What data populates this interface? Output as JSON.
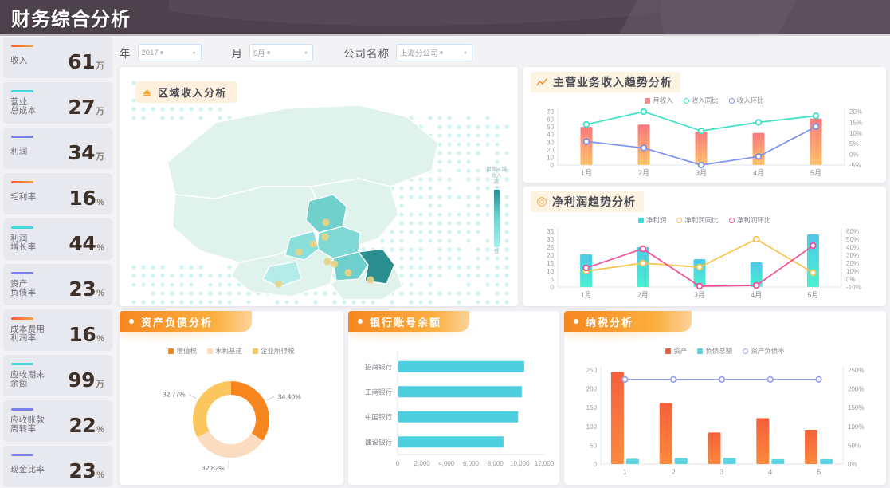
{
  "header": {
    "title": "财务综合分析"
  },
  "filters": {
    "year": {
      "label": "年",
      "value": "2017"
    },
    "month": {
      "label": "月",
      "value": "5月"
    },
    "company": {
      "label": "公司名称",
      "value": "上海分公司"
    }
  },
  "kpis": [
    {
      "label": "收入",
      "value": "61",
      "unit": "万",
      "color": "#f3843c"
    },
    {
      "label": "营业\n总成本",
      "value": "27",
      "unit": "万",
      "color": "#45d8e0"
    },
    {
      "label": "利润",
      "value": "34",
      "unit": "万",
      "color": "#7b7fe8"
    },
    {
      "label": "毛利率",
      "value": "16",
      "unit": "%",
      "color": "#f3843c"
    },
    {
      "label": "利润\n增长率",
      "value": "44",
      "unit": "%",
      "color": "#45d8e0"
    },
    {
      "label": "资产\n负债率",
      "value": "23",
      "unit": "%",
      "color": "#7b7fe8"
    },
    {
      "label": "成本费用\n利润率",
      "value": "16",
      "unit": "%",
      "color": "#f3843c"
    },
    {
      "label": "应收期末\n余额",
      "value": "99",
      "unit": "万",
      "color": "#45d8e0"
    },
    {
      "label": "应收账款\n周转率",
      "value": "22",
      "unit": "%",
      "color": "#7b7fe8"
    },
    {
      "label": "现金比率",
      "value": "23",
      "unit": "%",
      "color": "#7b7fe8"
    }
  ],
  "map": {
    "badge": "区域收入分析",
    "legend_title": "销售区域\n收入",
    "legend_high": "高",
    "legend_low": "低"
  },
  "panels": {
    "revenue_trend": "主营业务收入趋势分析",
    "profit_trend": "净利润趋势分析",
    "asset_liability": "资产负债分析",
    "bank_balance": "银行账号余额",
    "tax": "纳税分析"
  },
  "chart_data": [
    {
      "type": "bar",
      "id": "revenue-trend",
      "title": "主营业务收入趋势分析",
      "categories": [
        "1月",
        "2月",
        "3月",
        "4月",
        "5月"
      ],
      "ylim": [
        0,
        70
      ],
      "yticks": [
        0,
        10,
        20,
        30,
        40,
        50,
        60,
        70
      ],
      "y2lim": [
        -5,
        20
      ],
      "y2ticks": [
        "-5%",
        "0%",
        "5%",
        "10%",
        "15%",
        "20%"
      ],
      "legend_position": "top",
      "grid": false,
      "series": [
        {
          "name": "月收入",
          "kind": "bar",
          "color": "#f78b8b",
          "values": [
            50,
            53,
            44,
            42,
            61
          ]
        },
        {
          "name": "收入同比",
          "kind": "line",
          "color": "#3fe0c8",
          "values": [
            14,
            20,
            11,
            15,
            18
          ],
          "axis": "right"
        },
        {
          "name": "收入环比",
          "kind": "line",
          "color": "#7b92ee",
          "values": [
            6,
            3,
            -5,
            -1,
            13
          ],
          "axis": "right"
        }
      ]
    },
    {
      "type": "bar",
      "id": "profit-trend",
      "title": "净利润趋势分析",
      "categories": [
        "1月",
        "2月",
        "3月",
        "4月",
        "5月"
      ],
      "ylim": [
        0,
        35
      ],
      "yticks": [
        0,
        5,
        10,
        15,
        20,
        25,
        30,
        35
      ],
      "y2lim": [
        -10,
        60
      ],
      "y2ticks": [
        "-10%",
        "0%",
        "10%",
        "20%",
        "30%",
        "40%",
        "50%",
        "60%"
      ],
      "legend_position": "top",
      "grid": false,
      "series": [
        {
          "name": "净利润",
          "kind": "bar",
          "color": "#3fd8e0",
          "values": [
            20.5,
            25,
            17.5,
            15.5,
            33
          ]
        },
        {
          "name": "净利润同比",
          "kind": "line",
          "color": "#fbc54d",
          "values": [
            10,
            20,
            15,
            50,
            8
          ],
          "axis": "right"
        },
        {
          "name": "净利润环比",
          "kind": "line",
          "color": "#f5509a",
          "values": [
            14,
            38,
            -9,
            -8,
            42
          ],
          "axis": "right"
        }
      ]
    },
    {
      "type": "pie",
      "id": "asset-liability",
      "title": "资产负债分析",
      "labels": [
        "增值税",
        "水利基建",
        "企业所得税"
      ],
      "values": [
        34.4,
        32.82,
        32.77
      ],
      "value_labels": [
        "34.40%",
        "32.82%",
        "32.77%"
      ],
      "colors": [
        "#f7861f",
        "#fbdcc0",
        "#fcc65f"
      ],
      "legend_position": "top"
    },
    {
      "type": "bar",
      "id": "bank-balance",
      "title": "银行账号余额",
      "orientation": "horizontal",
      "categories": [
        "招商银行",
        "工商银行",
        "中国银行",
        "建设银行"
      ],
      "values": [
        10300,
        10100,
        9800,
        8600
      ],
      "xlim": [
        0,
        12000
      ],
      "xticks": [
        "0",
        "2,000",
        "4,000",
        "6,000",
        "8,000",
        "10,000",
        "12,000"
      ],
      "color": "#4ecfe0",
      "grid": false
    },
    {
      "type": "bar",
      "id": "tax-analysis",
      "title": "纳税分析",
      "categories": [
        "1",
        "2",
        "3",
        "4",
        "5"
      ],
      "ylim": [
        0,
        250
      ],
      "yticks": [
        0,
        50,
        100,
        150,
        200,
        250
      ],
      "y2lim": [
        0,
        250
      ],
      "y2ticks": [
        "0%",
        "50%",
        "100%",
        "150%",
        "200%",
        "250%"
      ],
      "legend_position": "top",
      "grid": false,
      "series": [
        {
          "name": "资产",
          "kind": "bar",
          "color": "#f4603c",
          "values": [
            245,
            162,
            84,
            122,
            91
          ]
        },
        {
          "name": "负债总额",
          "kind": "bar",
          "color": "#5dd6e3",
          "values": [
            14,
            16,
            16,
            13,
            13
          ]
        },
        {
          "name": "资产负债率",
          "kind": "line",
          "color": "#9aa3e8",
          "values": [
            225,
            225,
            225,
            225,
            225
          ],
          "axis": "right"
        }
      ]
    }
  ]
}
